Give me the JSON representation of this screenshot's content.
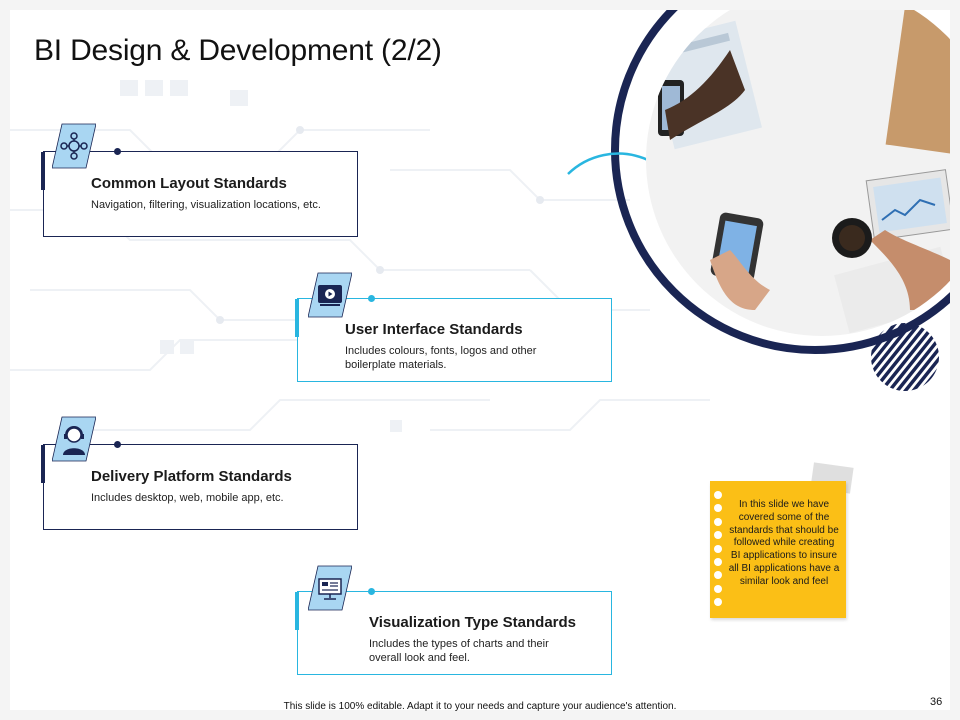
{
  "slide": {
    "title": "BI Design & Development (2/2)",
    "page_number": "36",
    "footer": "This slide is 100% editable. Adapt it to your needs and capture your audience's attention."
  },
  "cards": [
    {
      "title": "Common Layout Standards",
      "desc": "Navigation, filtering, visualization locations, etc.",
      "icon": "network-gears-icon",
      "style": "dark"
    },
    {
      "title": "User Interface Standards",
      "desc": "Includes colours, fonts, logos and other boilerplate materials.",
      "icon": "monitor-play-icon",
      "style": "light"
    },
    {
      "title": "Delivery Platform  Standards",
      "desc": "Includes desktop, web, mobile app, etc.",
      "icon": "support-agent-icon",
      "style": "dark"
    },
    {
      "title": "Visualization Type Standards",
      "desc": "Includes the types of charts and their overall look and feel.",
      "icon": "chart-display-icon",
      "style": "light"
    }
  ],
  "note": {
    "text": "In this slide we have covered some of the standards that should be followed while creating BI applications to insure all BI applications have a similar look and feel"
  },
  "colors": {
    "navy": "#1a2553",
    "cyan": "#29b6e0",
    "note_yellow": "#fbbf16",
    "icon_tile": "#a9d6f2"
  }
}
